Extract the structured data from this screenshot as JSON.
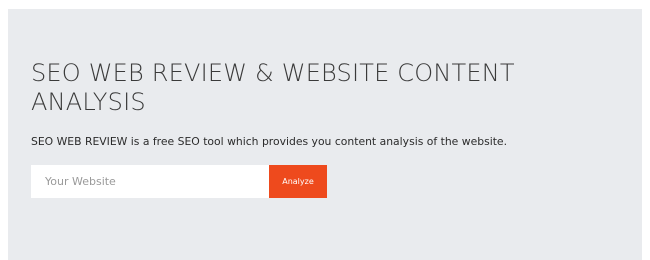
{
  "hero": {
    "title": "SEO WEB REVIEW & WEBSITE CONTENT ANALYSIS",
    "description": "SEO WEB REVIEW is a free SEO tool which provides you content analysis of the website.",
    "input": {
      "placeholder": "Your Website",
      "value": ""
    },
    "analyze_label": "Analyze"
  },
  "colors": {
    "panel_background": "#e9ebee",
    "accent": "#ee4a1d",
    "title_text": "#3a3a3a"
  }
}
